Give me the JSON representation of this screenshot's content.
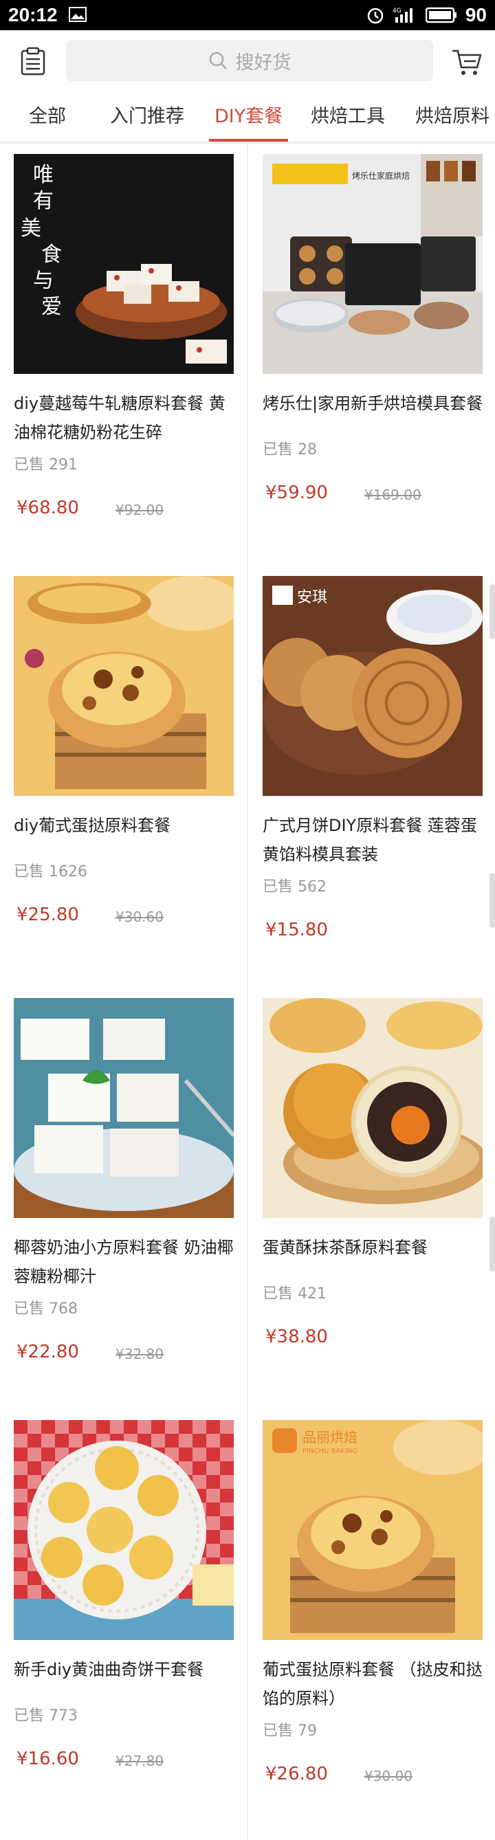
{
  "status": {
    "time": "20:12",
    "battery": "90",
    "network": "4G"
  },
  "search": {
    "placeholder": "搜好货"
  },
  "tabs": [
    {
      "label": "全部"
    },
    {
      "label": "入门推荐"
    },
    {
      "label": "DIY套餐",
      "active": true
    },
    {
      "label": "烘焙工具"
    },
    {
      "label": "烘焙原料"
    }
  ],
  "products": [
    {
      "title": "diy蔓越莓牛轧糖原料套餐 黄油棉花糖奶粉花生碎",
      "sold_label": "已售",
      "sold": "291",
      "price": "¥68.80",
      "old_price": "¥92.00",
      "image_text": [
        "唯",
        "有",
        "美",
        "食",
        "与",
        "爱"
      ]
    },
    {
      "title": "烤乐仕|家用新手烘培模具套餐",
      "sold_label": "已售",
      "sold": "28",
      "price": "¥59.90",
      "old_price": "¥169.00",
      "image_text": [
        "烤乐仕家庭烘焙"
      ]
    },
    {
      "title": "diy葡式蛋挞原料套餐",
      "sold_label": "已售",
      "sold": "1626",
      "price": "¥25.80",
      "old_price": "¥30.60"
    },
    {
      "title": "广式月饼DIY原料套餐 莲蓉蛋黄馅料模具套装",
      "sold_label": "已售",
      "sold": "562",
      "price": "¥15.80",
      "old_price": "",
      "image_text": [
        "安琪"
      ]
    },
    {
      "title": "椰蓉奶油小方原料套餐 奶油椰蓉糖粉椰汁",
      "sold_label": "已售",
      "sold": "768",
      "price": "¥22.80",
      "old_price": "¥32.80"
    },
    {
      "title": "蛋黄酥抹茶酥原料套餐",
      "sold_label": "已售",
      "sold": "421",
      "price": "¥38.80",
      "old_price": ""
    },
    {
      "title": "新手diy黄油曲奇饼干套餐",
      "sold_label": "已售",
      "sold": "773",
      "price": "¥16.60",
      "old_price": "¥27.80"
    },
    {
      "title": "葡式蛋挞原料套餐 （挞皮和挞馅的原料）",
      "sold_label": "已售",
      "sold": "79",
      "price": "¥26.80",
      "old_price": "¥30.00",
      "image_text": [
        "品丽烘焙",
        "PINCHU BAKING"
      ]
    }
  ],
  "colors": {
    "accent": "#d24b3e",
    "price": "#c0392b"
  }
}
